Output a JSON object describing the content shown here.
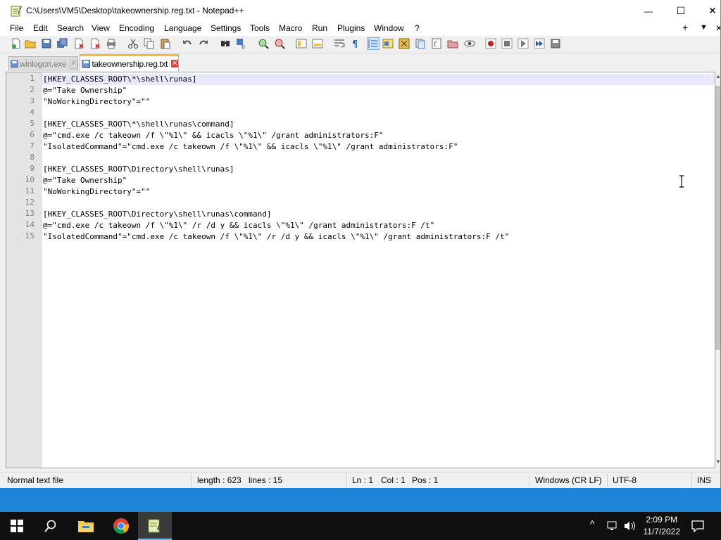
{
  "window": {
    "title": "C:\\Users\\VM5\\Desktop\\takeownership.reg.txt - Notepad++",
    "controls": {
      "minimize": "—",
      "maximize": "☐",
      "close": "✕"
    },
    "right_buttons": {
      "add": "+",
      "dropdown": "▼",
      "close": "✕"
    }
  },
  "menu": [
    "File",
    "Edit",
    "Search",
    "View",
    "Encoding",
    "Language",
    "Settings",
    "Tools",
    "Macro",
    "Run",
    "Plugins",
    "Window",
    "?"
  ],
  "tabs": [
    {
      "label": "winlogon.exe",
      "active": false
    },
    {
      "label": "takeownership.reg.txt",
      "active": true
    }
  ],
  "editor": {
    "line_numbers": [
      "1",
      "2",
      "3",
      "4",
      "5",
      "6",
      "7",
      "8",
      "9",
      "10",
      "11",
      "12",
      "13",
      "14",
      "15"
    ],
    "lines": [
      "[HKEY_CLASSES_ROOT\\*\\shell\\runas]",
      "@=\"Take Ownership\"",
      "\"NoWorkingDirectory\"=\"\"",
      "",
      "[HKEY_CLASSES_ROOT\\*\\shell\\runas\\command]",
      "@=\"cmd.exe /c takeown /f \\\"%1\\\" && icacls \\\"%1\\\" /grant administrators:F\"",
      "\"IsolatedCommand\"=\"cmd.exe /c takeown /f \\\"%1\\\" && icacls \\\"%1\\\" /grant administrators:F\"",
      "",
      "[HKEY_CLASSES_ROOT\\Directory\\shell\\runas]",
      "@=\"Take Ownership\"",
      "\"NoWorkingDirectory\"=\"\"",
      "",
      "[HKEY_CLASSES_ROOT\\Directory\\shell\\runas\\command]",
      "@=\"cmd.exe /c takeown /f \\\"%1\\\" /r /d y && icacls \\\"%1\\\" /grant administrators:F /t\"",
      "\"IsolatedCommand\"=\"cmd.exe /c takeown /f \\\"%1\\\" /r /d y && icacls \\\"%1\\\" /grant administrators:F /t\""
    ]
  },
  "status": {
    "file_type": "Normal text file",
    "length": "length : 623",
    "lines": "lines : 15",
    "ln": "Ln : 1",
    "col": "Col : 1",
    "pos": "Pos : 1",
    "eol": "Windows (CR LF)",
    "encoding": "UTF-8",
    "mode": "INS"
  },
  "taskbar": {
    "time": "2:09 PM",
    "date": "11/7/2022"
  },
  "colors": {
    "active_tab_accent": "#fab833",
    "current_line": "#e8e8ff",
    "taskbar": "#101010",
    "desktop": "#1f86d9"
  }
}
